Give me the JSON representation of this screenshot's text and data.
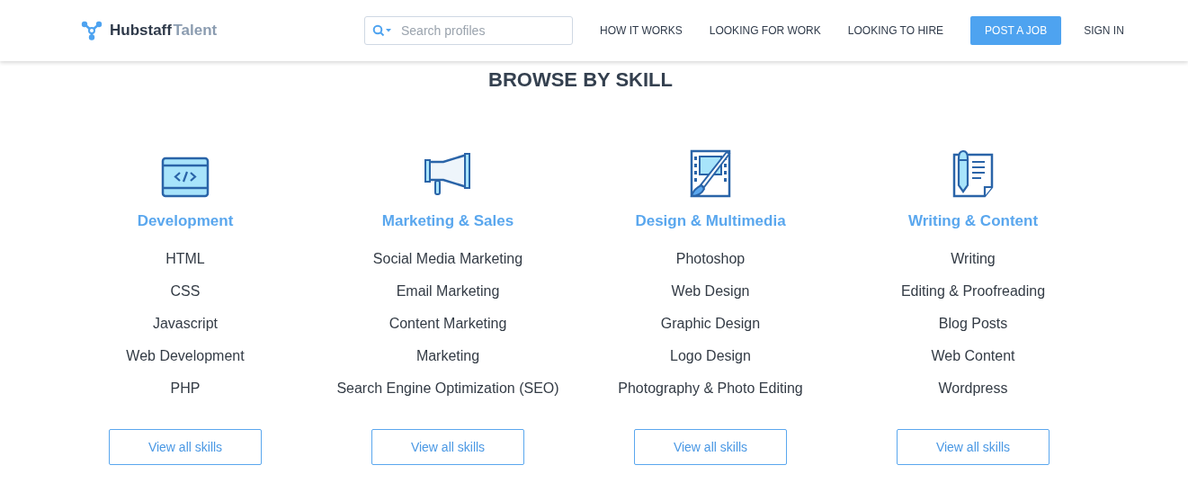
{
  "header": {
    "logo": {
      "name": "Hubstaff",
      "suffix": "Talent"
    },
    "search": {
      "placeholder": "Search profiles"
    },
    "nav": [
      {
        "label": "HOW IT WORKS",
        "kind": "link"
      },
      {
        "label": "LOOKING FOR WORK",
        "kind": "link"
      },
      {
        "label": "LOOKING TO HIRE",
        "kind": "link"
      },
      {
        "label": "POST A JOB",
        "kind": "primary"
      },
      {
        "label": "SIGN IN",
        "kind": "link"
      }
    ]
  },
  "title": "BROWSE BY SKILL",
  "categories": [
    {
      "kind": "code",
      "name": "Development",
      "skills": [
        "HTML",
        "CSS",
        "Javascript",
        "Web Development",
        "PHP"
      ],
      "button": "View all skills"
    },
    {
      "kind": "megaphone",
      "name": "Marketing & Sales",
      "skills": [
        "Social Media Marketing",
        "Email Marketing",
        "Content Marketing",
        "Marketing",
        "Search Engine Optimization (SEO)"
      ],
      "button": "View all skills"
    },
    {
      "kind": "film",
      "name": "Design & Multimedia",
      "skills": [
        "Photoshop",
        "Web Design",
        "Graphic Design",
        "Logo Design",
        "Photography & Photo Editing"
      ],
      "button": "View all skills"
    },
    {
      "kind": "document",
      "name": "Writing & Content",
      "skills": [
        "Writing",
        "Editing & Proofreading",
        "Blog Posts",
        "Web Content",
        "Wordpress"
      ],
      "button": "View all skills"
    }
  ]
}
